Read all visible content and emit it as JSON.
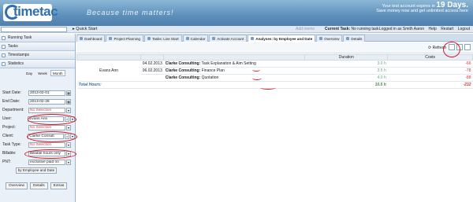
{
  "header": {
    "logo_text": "timetac",
    "tagline": "Because time matters!",
    "trial_line1": "Your test account expires in",
    "trial_days": "19 Days.",
    "trial_line2": "Save money now and get unlimited access here"
  },
  "toolbar": {
    "quick_start": "Quick Start",
    "add_memo": "Add memo",
    "current_task_label": "Current Task:",
    "current_task_value": "No running task",
    "logged_in": "Logged in as Smith Aaron",
    "help": "Help",
    "restart": "Restart",
    "logout": "Logout"
  },
  "tabs": [
    {
      "label": "Dashboard"
    },
    {
      "label": "Project Planning"
    },
    {
      "label": "Tasks: Live Start"
    },
    {
      "label": "Calendar"
    },
    {
      "label": "Activate Account"
    },
    {
      "label": "Analyses: by Employee and Date"
    },
    {
      "label": "Overview"
    },
    {
      "label": "Details"
    }
  ],
  "sidebar": {
    "panels": [
      "Running Task",
      "Tasks",
      "Timestamps",
      "Statistics"
    ],
    "view_tabs": [
      "Day",
      "Week",
      "Month"
    ],
    "filters": [
      {
        "label": "Start Date:",
        "value": "2013-02-01",
        "placeholder": false
      },
      {
        "label": "End Date:",
        "value": "2013-02-28",
        "placeholder": false
      },
      {
        "label": "Department:",
        "value": "No Selection",
        "placeholder": true
      },
      {
        "label": "User:",
        "value": "Evans Ann",
        "placeholder": false
      },
      {
        "label": "Project:",
        "value": "No Selection",
        "placeholder": true
      },
      {
        "label": "Client:",
        "value": "Clarke Consult",
        "placeholder": false
      },
      {
        "label": "Task Type:",
        "value": "No Selection",
        "placeholder": true
      },
      {
        "label": "Billable:",
        "value": "Billable hours only",
        "placeholder": false
      },
      {
        "label": "PNT:",
        "value": "exclusive paid no",
        "placeholder": false
      }
    ],
    "by_button": "by Employee and Date",
    "bottom_buttons": [
      "Overview",
      "Details",
      "Extras"
    ]
  },
  "main": {
    "refresh": "Refresh",
    "columns": [
      "",
      "",
      "",
      "Duration",
      "Costs"
    ],
    "rows": [
      {
        "employee": "Evans Ann",
        "date": "04.02.2013",
        "client": "Clarke Consulting:",
        "task": "Task Explanation & Aim Setting",
        "duration": "3.0 h",
        "cost": "-66"
      },
      {
        "employee": "",
        "date": "06.02.2013",
        "client": "Clarke Consulting:",
        "task": "Finance Plan",
        "duration": "3.5 h",
        "cost": "-78"
      },
      {
        "employee": "",
        "date": "",
        "client": "Clarke Consulting:",
        "task": "Quotation",
        "duration": "4.0 h",
        "cost": "-88"
      }
    ],
    "total_label": "Total Hours:",
    "total_duration": "10.5 h",
    "total_cost": "-232"
  },
  "colors": {
    "accent": "#5d8fbb",
    "annotation": "#e0121c",
    "cost": "#dd3333"
  }
}
